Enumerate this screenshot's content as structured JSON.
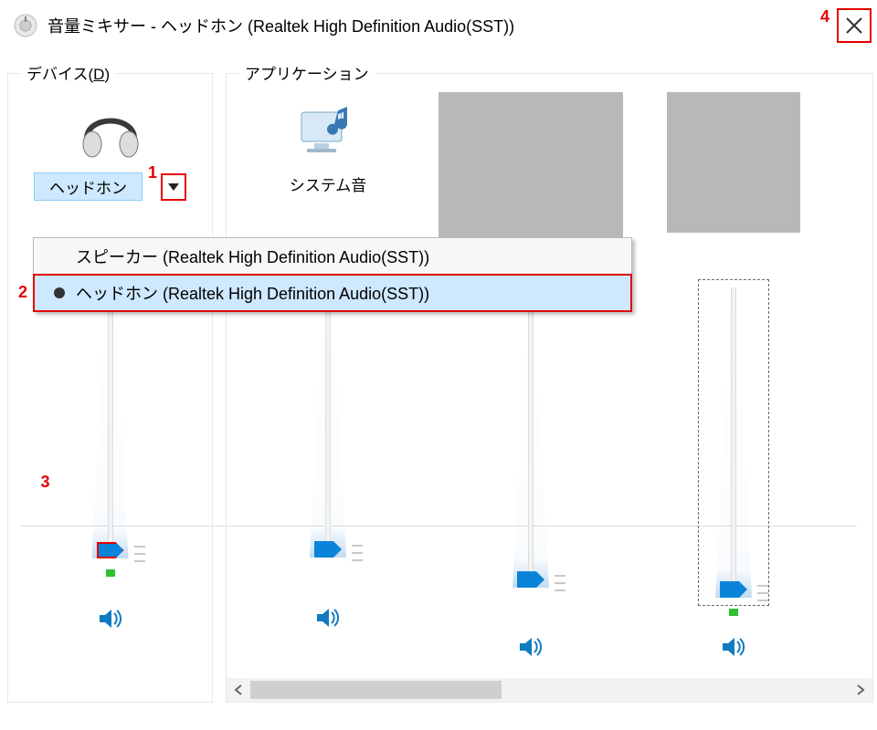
{
  "window": {
    "title": "音量ミキサー - ヘッドホン (Realtek High Definition Audio(SST))"
  },
  "panes": {
    "device_section_label_pre": "デバイス(",
    "device_section_hotkey": "D",
    "device_section_label_post": ")",
    "apps_section_label": "アプリケーション"
  },
  "device": {
    "selected_name": "ヘッドホン",
    "dropdown_open": true,
    "options": [
      {
        "label": "スピーカー (Realtek High Definition Audio(SST))",
        "selected": false
      },
      {
        "label": "ヘッドホン (Realtek High Definition Audio(SST))",
        "selected": true
      }
    ],
    "volume_percent": 4,
    "muted": false
  },
  "apps": [
    {
      "name": "システム音",
      "icon": "system-sounds",
      "volume_percent": 4,
      "muted": false
    },
    {
      "name": "",
      "icon": "placeholder",
      "volume_percent": 4,
      "muted": false
    },
    {
      "name": "",
      "icon": "placeholder",
      "volume_percent": 4,
      "muted": false,
      "focused": true
    }
  ],
  "annotations": {
    "m1": "1",
    "m2": "2",
    "m3": "3",
    "m4": "4"
  },
  "colors": {
    "accent": "#0a84d8",
    "highlight": "#cde8ff",
    "annotation": "#e60000"
  }
}
